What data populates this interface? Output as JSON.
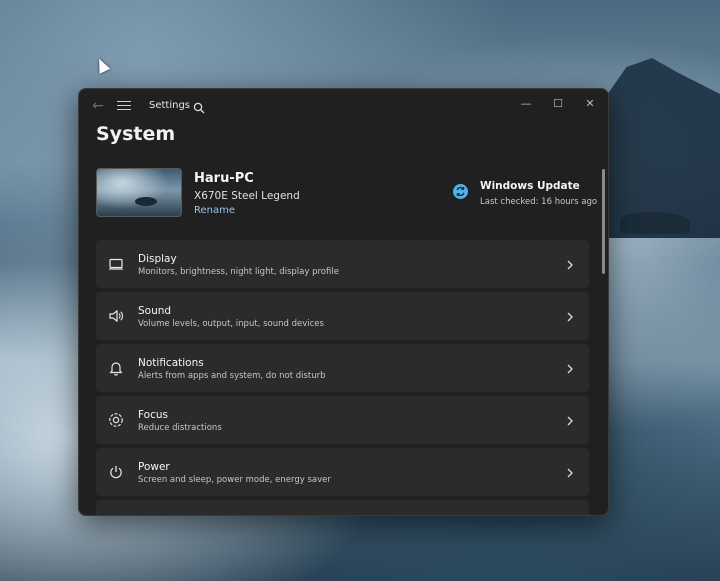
{
  "window": {
    "app_title": "Settings",
    "page_title": "System",
    "controls": {
      "minimize": "—",
      "maximize": "☐",
      "close": "✕"
    }
  },
  "device": {
    "name": "Haru-PC",
    "model": "X670E Steel Legend",
    "rename_label": "Rename"
  },
  "windows_update": {
    "title": "Windows Update",
    "status": "Last checked: 16 hours ago",
    "accent": "#4fb3e6"
  },
  "settings_list": [
    {
      "label": "Display",
      "description": "Monitors, brightness, night light, display profile",
      "icon": "monitor-icon"
    },
    {
      "label": "Sound",
      "description": "Volume levels, output, input, sound devices",
      "icon": "speaker-icon"
    },
    {
      "label": "Notifications",
      "description": "Alerts from apps and system, do not disturb",
      "icon": "bell-icon"
    },
    {
      "label": "Focus",
      "description": "Reduce distractions",
      "icon": "focus-icon"
    },
    {
      "label": "Power",
      "description": "Screen and sleep, power mode, energy saver",
      "icon": "power-icon"
    }
  ],
  "colors": {
    "window_bg": "#202020",
    "card_bg": "#2b2b2b",
    "link": "#99c4ef"
  }
}
